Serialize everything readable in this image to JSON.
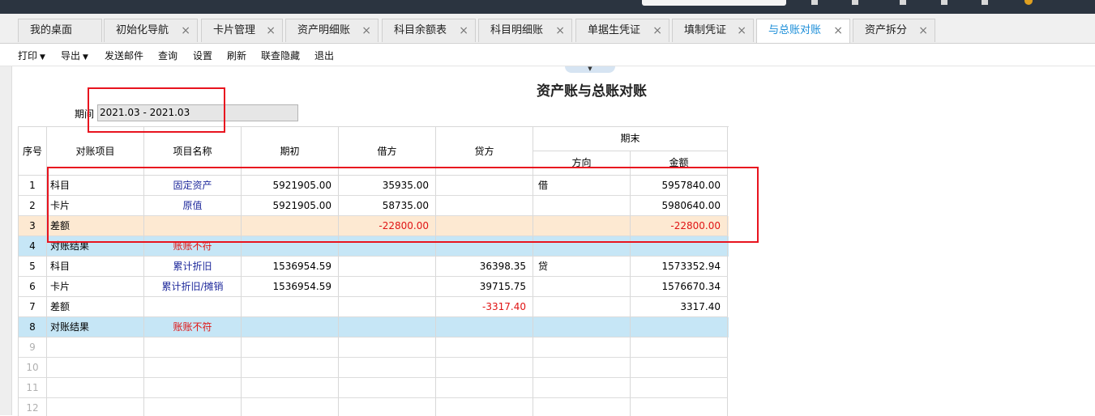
{
  "tabs": [
    {
      "label": "我的桌面",
      "closable": false
    },
    {
      "label": "初始化导航",
      "closable": true
    },
    {
      "label": "卡片管理",
      "closable": true
    },
    {
      "label": "资产明细账",
      "closable": true
    },
    {
      "label": "科目余额表",
      "closable": true
    },
    {
      "label": "科目明细账",
      "closable": true
    },
    {
      "label": "单据生凭证",
      "closable": true
    },
    {
      "label": "填制凭证",
      "closable": true
    },
    {
      "label": "与总账对账",
      "closable": true,
      "active": true
    },
    {
      "label": "资产拆分",
      "closable": true
    }
  ],
  "toolbar": {
    "print": "打印",
    "export": "导出",
    "send_mail": "发送邮件",
    "query": "查询",
    "settings": "设置",
    "refresh": "刷新",
    "link_hide": "联查隐藏",
    "exit": "退出"
  },
  "report": {
    "title": "资产账与总账对账",
    "period_label": "期间",
    "period_value": "2021.03 - 2021.03"
  },
  "table": {
    "headers": {
      "seq": "序号",
      "item": "对账项目",
      "name": "项目名称",
      "opening": "期初",
      "debit": "借方",
      "credit": "贷方",
      "ending": "期末",
      "direction": "方向",
      "amount": "金额"
    },
    "rows": [
      {
        "seq": "1",
        "item": "科目",
        "name": "固定资产",
        "opening": "5921905.00",
        "debit": "35935.00",
        "credit": "",
        "direction": "借",
        "amount": "5957840.00",
        "type": "normal"
      },
      {
        "seq": "2",
        "item": "卡片",
        "name": "原值",
        "opening": "5921905.00",
        "debit": "58735.00",
        "credit": "",
        "direction": "",
        "amount": "5980640.00",
        "type": "normal"
      },
      {
        "seq": "3",
        "item": "差额",
        "name": "",
        "opening": "",
        "debit": "-22800.00",
        "credit": "",
        "direction": "",
        "amount": "-22800.00",
        "type": "diff"
      },
      {
        "seq": "4",
        "item": "对账结果",
        "name": "账账不符",
        "opening": "",
        "debit": "",
        "credit": "",
        "direction": "",
        "amount": "",
        "type": "result"
      },
      {
        "seq": "5",
        "item": "科目",
        "name": "累计折旧",
        "opening": "1536954.59",
        "debit": "",
        "credit": "36398.35",
        "direction": "贷",
        "amount": "1573352.94",
        "type": "normal"
      },
      {
        "seq": "6",
        "item": "卡片",
        "name": "累计折旧/摊销",
        "opening": "1536954.59",
        "debit": "",
        "credit": "39715.75",
        "direction": "",
        "amount": "1576670.34",
        "type": "normal"
      },
      {
        "seq": "7",
        "item": "差额",
        "name": "",
        "opening": "",
        "debit": "",
        "credit": "-3317.40",
        "direction": "",
        "amount": "3317.40",
        "type": "normal"
      },
      {
        "seq": "8",
        "item": "对账结果",
        "name": "账账不符",
        "opening": "",
        "debit": "",
        "credit": "",
        "direction": "",
        "amount": "",
        "type": "result"
      },
      {
        "seq": "9",
        "item": "",
        "name": "",
        "opening": "",
        "debit": "",
        "credit": "",
        "direction": "",
        "amount": "",
        "type": "empty"
      },
      {
        "seq": "10",
        "item": "",
        "name": "",
        "opening": "",
        "debit": "",
        "credit": "",
        "direction": "",
        "amount": "",
        "type": "empty"
      },
      {
        "seq": "11",
        "item": "",
        "name": "",
        "opening": "",
        "debit": "",
        "credit": "",
        "direction": "",
        "amount": "",
        "type": "empty"
      },
      {
        "seq": "12",
        "item": "",
        "name": "",
        "opening": "",
        "debit": "",
        "credit": "",
        "direction": "",
        "amount": "",
        "type": "empty"
      }
    ]
  },
  "colors": {
    "active_tab": "#1a8dd8",
    "annotation_box": "#e8141f",
    "negative_value": "#e01414",
    "result_row": "#c6e6f6",
    "diff_row": "#fde9d2"
  },
  "icons": {
    "tab_close": "close-icon",
    "dropdown": "caret-down-icon",
    "collapse": "collapse-arrow-icon"
  }
}
